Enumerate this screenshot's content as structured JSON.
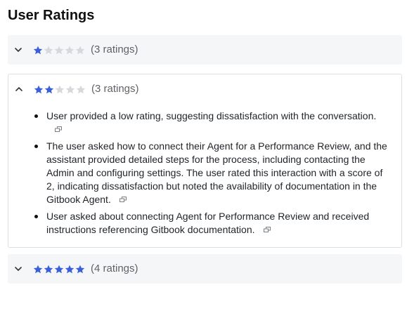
{
  "page": {
    "title": "User Ratings"
  },
  "colors": {
    "star_filled": "#3b5fd9",
    "star_empty": "#d5d8dc"
  },
  "groups": [
    {
      "stars": 1,
      "max_stars": 5,
      "count_label": "(3 ratings)",
      "expanded": false
    },
    {
      "stars": 2,
      "max_stars": 5,
      "count_label": "(3 ratings)",
      "expanded": true,
      "items": [
        "User provided a low rating, suggesting dissatisfaction with the conversation.",
        "The user asked how to connect their Agent for a Performance Review, and the assistant provided detailed steps for the process, including contacting the Admin and configuring settings. The user rated this interaction with a score of 2, indicating dissatisfaction but noted the availability of documentation in the Gitbook Agent.",
        "User asked about connecting Agent for Performance Review and received instructions referencing Gitbook documentation."
      ]
    },
    {
      "stars": 5,
      "max_stars": 5,
      "count_label": "(4 ratings)",
      "expanded": false
    }
  ]
}
